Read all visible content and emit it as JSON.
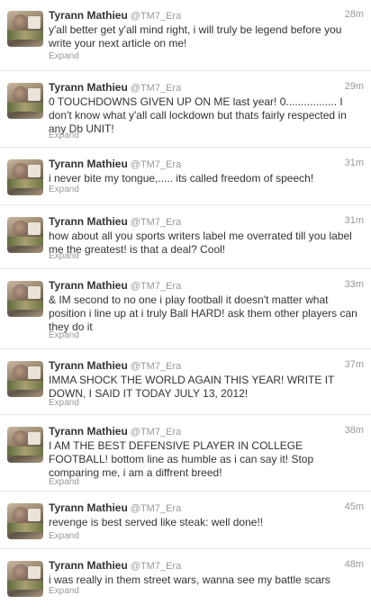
{
  "tweets": [
    {
      "name": "Tyrann Mathieu",
      "handle": "@TM7_Era",
      "time": "28m",
      "text": "y'all better get y'all mind right, i will truly be legend before you write your next article on me!",
      "expand": "Expand"
    },
    {
      "name": "Tyrann Mathieu",
      "handle": "@TM7_Era",
      "time": "29m",
      "text": "0 TOUCHDOWNS GIVEN UP ON ME last year! 0................. I don't know what y'all call lockdown but thats fairly respected in any Db UNIT!",
      "expand": "Expand"
    },
    {
      "name": "Tyrann Mathieu",
      "handle": "@TM7_Era",
      "time": "31m",
      "text": "i never bite my tongue,..... its called freedom of speech!",
      "expand": "Expand"
    },
    {
      "name": "Tyrann Mathieu",
      "handle": "@TM7_Era",
      "time": "31m",
      "text": "how about all you sports writers label me overrated till you label me the greatest! is that a deal? Cool!",
      "expand": "Expand"
    },
    {
      "name": "Tyrann Mathieu",
      "handle": "@TM7_Era",
      "time": "33m",
      "text": "& IM second to no one i play football it doesn't matter what position i line up at i truly Ball HARD! ask them other players can they do it",
      "expand": "Expand"
    },
    {
      "name": "Tyrann Mathieu",
      "handle": "@TM7_Era",
      "time": "37m",
      "text": "IMMA SHOCK THE WORLD AGAIN THIS YEAR! WRITE IT DOWN, I SAID IT TODAY JULY 13, 2012!",
      "expand": "Expand"
    },
    {
      "name": "Tyrann Mathieu",
      "handle": "@TM7_Era",
      "time": "38m",
      "text": "I AM THE BEST DEFENSIVE PLAYER IN COLLEGE FOOTBALL! bottom line as humble as i can say it! Stop comparing me, i am a diffrent breed!",
      "expand": "Expand"
    },
    {
      "name": "Tyrann Mathieu",
      "handle": "@TM7_Era",
      "time": "45m",
      "text": "revenge is best served like steak: well done!!",
      "expand": "Expand"
    },
    {
      "name": "Tyrann Mathieu",
      "handle": "@TM7_Era",
      "time": "48m",
      "text": "i was really in them street wars, wanna see my battle scars",
      "expand": "Expand"
    }
  ]
}
